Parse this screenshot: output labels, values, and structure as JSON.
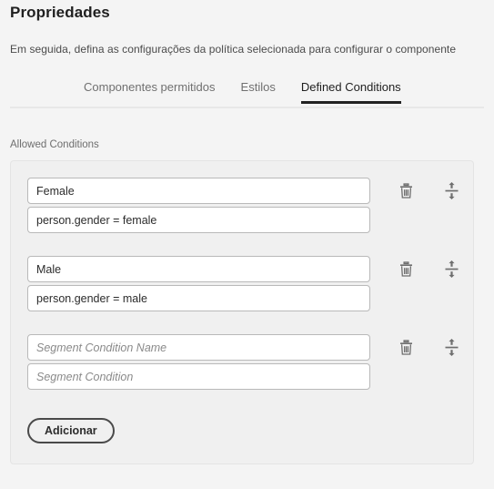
{
  "header": {
    "title": "Propriedades",
    "subtitle": "Em seguida, defina as configurações da política selecionada para configurar o componente"
  },
  "tabs": [
    {
      "label": "Componentes permitidos",
      "active": false
    },
    {
      "label": "Estilos",
      "active": false
    },
    {
      "label": "Defined Conditions",
      "active": true
    }
  ],
  "conditions_section": {
    "label": "Allowed Conditions",
    "groups": [
      {
        "name_value": "Female",
        "name_placeholder": "Segment Condition Name",
        "condition_value": "person.gender = female",
        "condition_placeholder": "Segment Condition",
        "delete_icon": "trash-icon",
        "reorder_icon": "reorder-vertical-icon"
      },
      {
        "name_value": "Male",
        "name_placeholder": "Segment Condition Name",
        "condition_value": "person.gender = male",
        "condition_placeholder": "Segment Condition",
        "delete_icon": "trash-icon",
        "reorder_icon": "reorder-vertical-icon"
      },
      {
        "name_value": "",
        "name_placeholder": "Segment Condition Name",
        "condition_value": "",
        "condition_placeholder": "Segment Condition",
        "delete_icon": "trash-icon",
        "reorder_icon": "reorder-vertical-icon"
      }
    ],
    "add_button_label": "Adicionar"
  },
  "colors": {
    "page_background": "#f4f4f4",
    "panel_background": "#f0f0f0",
    "panel_border": "#e4e4e4",
    "input_border": "#b9b9b9",
    "active_tab_underline": "#222222",
    "tab_inactive_text": "#707070",
    "icon_gray": "#6e6e6e",
    "button_border": "#4a4a4a"
  }
}
